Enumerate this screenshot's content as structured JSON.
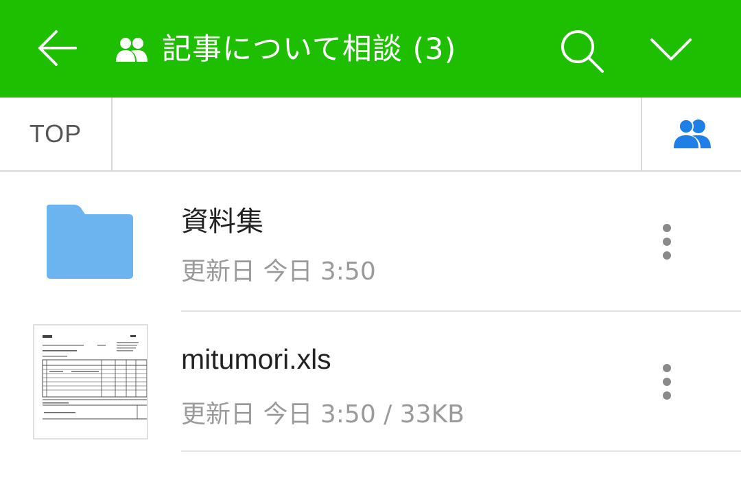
{
  "header": {
    "title": "記事について相談 (3)",
    "background_color": "#1dbf00",
    "icons": {
      "back": "back-arrow-icon",
      "group": "group-icon",
      "search": "search-icon",
      "dropdown": "chevron-down-icon"
    }
  },
  "subbar": {
    "top_label": "TOP",
    "members_icon": "members-icon",
    "accent_color": "#1e7fe6"
  },
  "files": [
    {
      "name": "資料集",
      "meta": "更新日 今日 3:50",
      "type": "folder",
      "icon": "folder-icon",
      "folder_color": "#6cb4ef"
    },
    {
      "name": "mitumori.xls",
      "meta": "更新日 今日 3:50 / 33KB",
      "type": "file",
      "icon": "spreadsheet-thumbnail"
    }
  ],
  "more_icon": "more-vertical-icon"
}
